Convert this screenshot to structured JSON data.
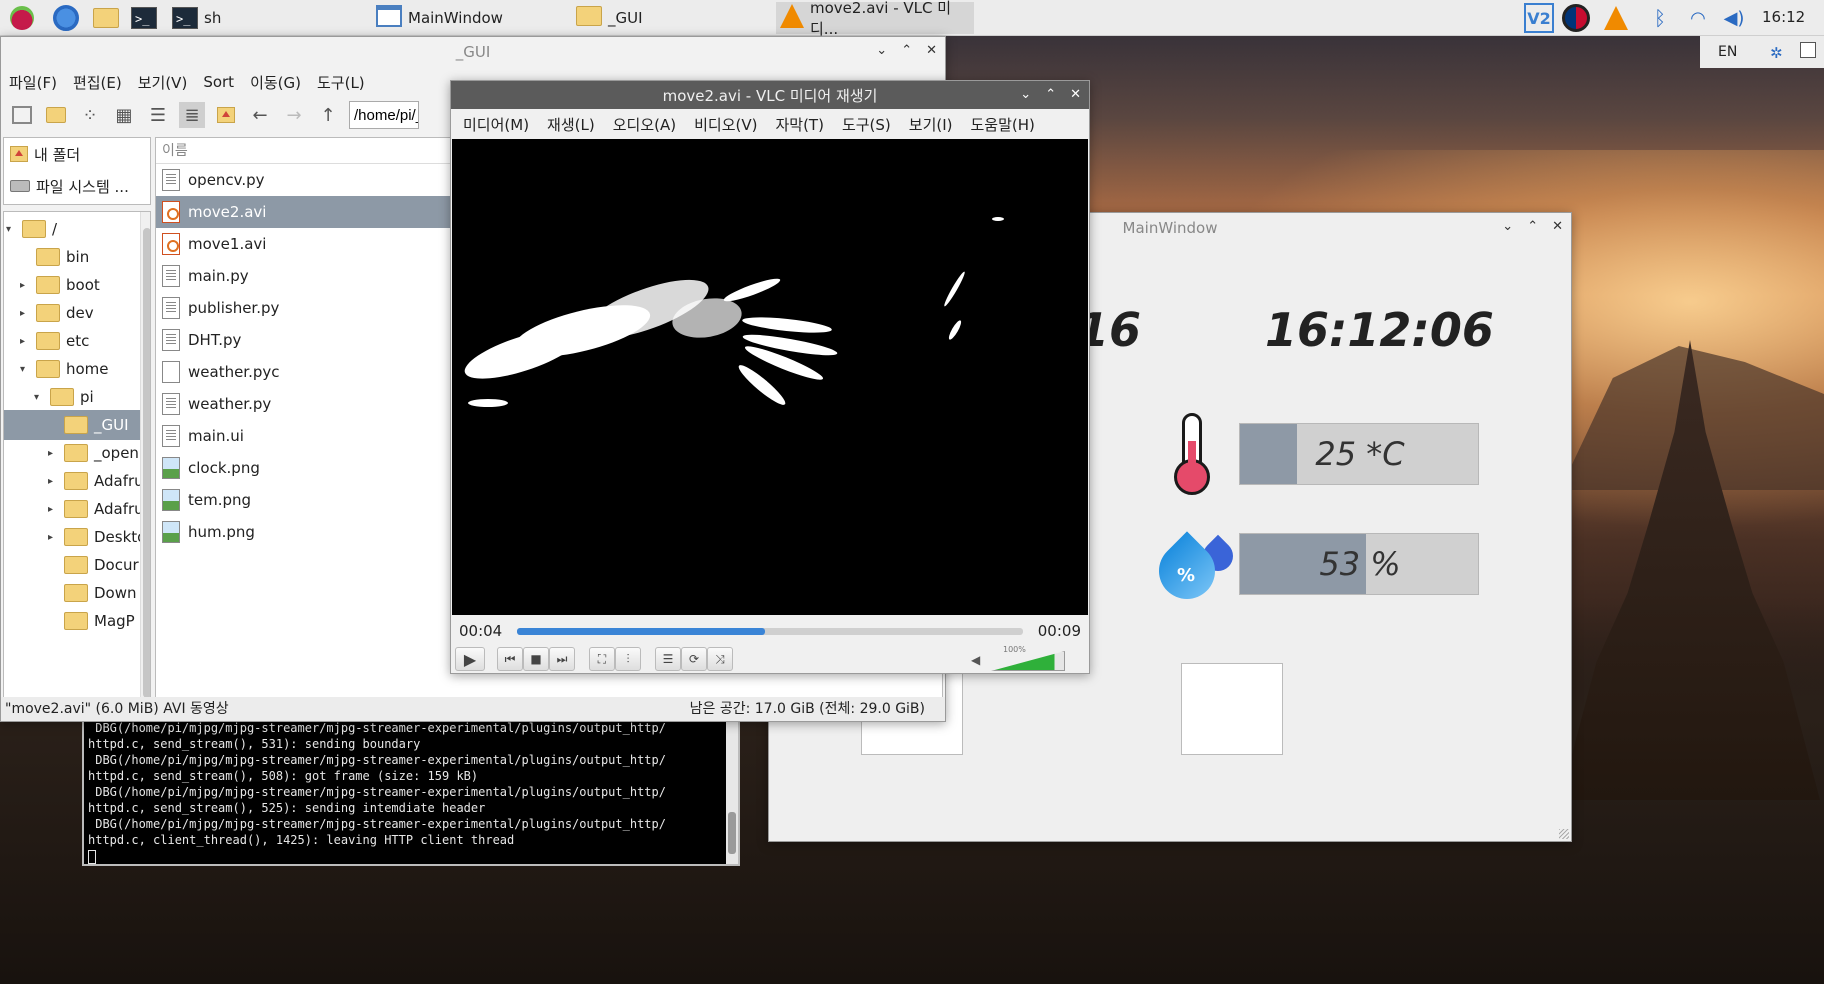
{
  "taskbar": {
    "tasks": [
      {
        "label": "sh",
        "icon": "terminal-icon"
      },
      {
        "label": "MainWindow",
        "icon": "window-icon"
      },
      {
        "label": "_GUI",
        "icon": "folder-icon"
      },
      {
        "label": "move2.avi - VLC 미디...",
        "icon": "vlc-icon"
      }
    ],
    "time": "16:12"
  },
  "file_manager": {
    "title": "_GUI",
    "menu": [
      "파일(F)",
      "편집(E)",
      "보기(V)",
      "Sort",
      "이동(G)",
      "도구(L)"
    ],
    "path": "/home/pi/_GUI",
    "places": [
      "내 폴더",
      "파일 시스템 ..."
    ],
    "tree": [
      {
        "label": "/",
        "arrow": "▾"
      },
      {
        "label": "bin",
        "arrow": ""
      },
      {
        "label": "boot",
        "arrow": "▸"
      },
      {
        "label": "dev",
        "arrow": "▸"
      },
      {
        "label": "etc",
        "arrow": "▸"
      },
      {
        "label": "home",
        "arrow": "▾"
      },
      {
        "label": "pi",
        "arrow": "▾"
      },
      {
        "label": "_GUI",
        "arrow": ""
      },
      {
        "label": "_open",
        "arrow": "▸"
      },
      {
        "label": "Adafru",
        "arrow": "▸"
      },
      {
        "label": "Adafru",
        "arrow": "▸"
      },
      {
        "label": "Deskto",
        "arrow": "▸"
      },
      {
        "label": "Docur",
        "arrow": ""
      },
      {
        "label": "Down",
        "arrow": ""
      },
      {
        "label": "MagP",
        "arrow": ""
      }
    ],
    "column_header": "이름",
    "files": [
      {
        "name": "opencv.py",
        "type": "txt"
      },
      {
        "name": "move2.avi",
        "type": "vid"
      },
      {
        "name": "move1.avi",
        "type": "vid"
      },
      {
        "name": "main.py",
        "type": "txt"
      },
      {
        "name": "publisher.py",
        "type": "txt"
      },
      {
        "name": "DHT.py",
        "type": "txt"
      },
      {
        "name": "weather.pyc",
        "type": "doc"
      },
      {
        "name": "weather.py",
        "type": "txt"
      },
      {
        "name": "main.ui",
        "type": "txt"
      },
      {
        "name": "clock.png",
        "type": "img"
      },
      {
        "name": "tem.png",
        "type": "img"
      },
      {
        "name": "hum.png",
        "type": "img"
      }
    ],
    "selected_file": "move2.avi",
    "status_left": "\"move2.avi\" (6.0 MiB) AVI 동영상",
    "status_right": "남은 공간: 17.0 GiB (전체: 29.0 GiB)"
  },
  "terminal": {
    "lines": [
      "httpd.c, send_stream(), 531): sending boundary",
      " DBG(/home/pi/mjpg/mjpg-streamer/mjpg-streamer-experimental/plugins/output_http/",
      "httpd.c, send_stream(), 508): got frame (size: 159 kB)",
      " DBG(/home/pi/mjpg/mjpg-streamer/mjpg-streamer-experimental/plugins/output_http/",
      "httpd.c, send_stream(), 525): sending intemdiate header",
      " DBG(/home/pi/mjpg/mjpg-streamer/mjpg-streamer-experimental/plugins/output_http/",
      "httpd.c, client_thread(), 1425): leaving HTTP client thread"
    ],
    "first_line": " DBG(/home/pi/mjpg/mjpg-streamer/mjpg-streamer-experimental/plugins/output_http/"
  },
  "vlc": {
    "title": "move2.avi - VLC 미디어 재생기",
    "menu": [
      "미디어(M)",
      "재생(L)",
      "오디오(A)",
      "비디오(V)",
      "자막(T)",
      "도구(S)",
      "보기(I)",
      "도움말(H)"
    ],
    "time_elapsed": "00:04",
    "time_total": "00:09",
    "progress": 0.49,
    "volume_label": "100%",
    "volume": 0.87
  },
  "main_window": {
    "title": "MainWindow",
    "date_partial": "06-16",
    "time": "16:12:06",
    "temperature": {
      "text": "25 *C",
      "fill": 0.24
    },
    "humidity": {
      "text": "53 %",
      "fill": 0.53
    }
  },
  "tray": {
    "keyboard": "EN"
  }
}
